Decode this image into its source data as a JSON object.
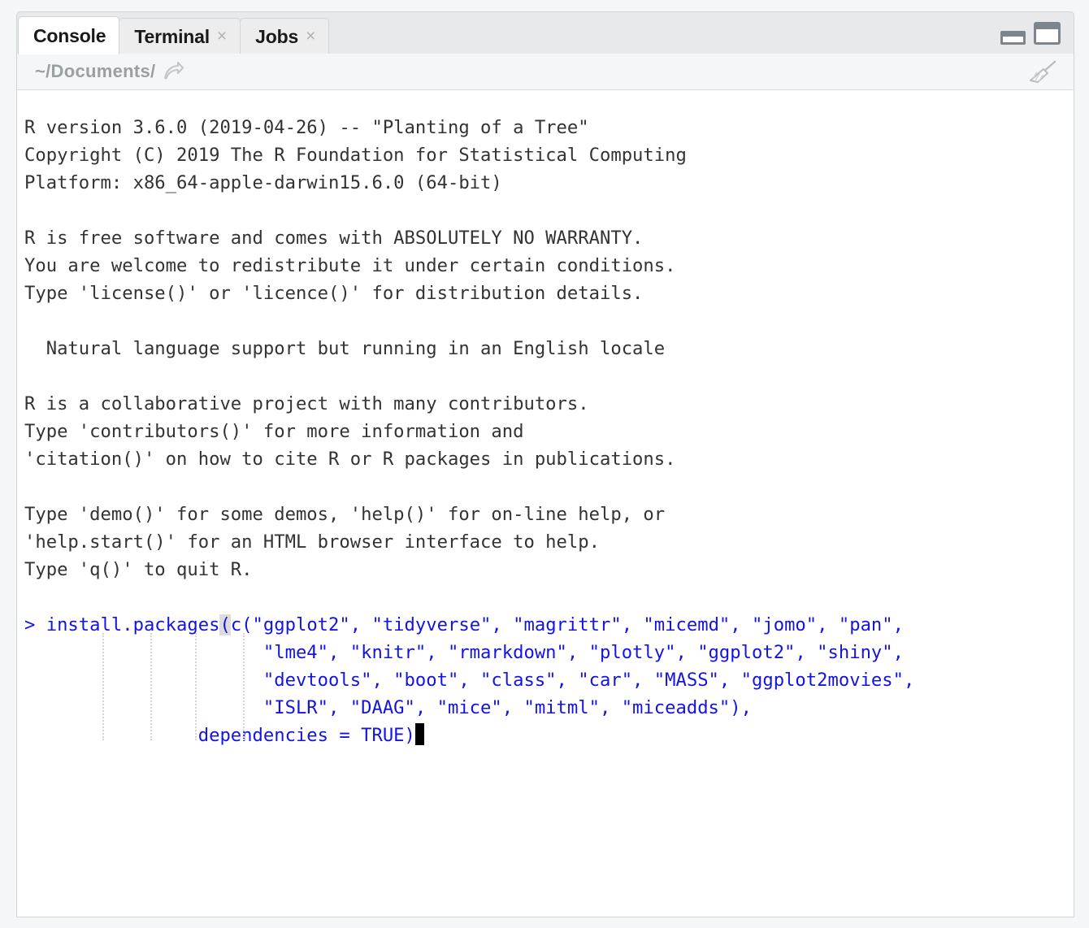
{
  "window": {
    "tabs": [
      {
        "label": "Console",
        "active": true,
        "closable": false
      },
      {
        "label": "Terminal",
        "active": false,
        "closable": true
      },
      {
        "label": "Jobs",
        "active": false,
        "closable": true
      }
    ],
    "close_glyph": "×",
    "minimize_label": "minimize-pane",
    "maximize_label": "maximize-pane"
  },
  "pathbar": {
    "path": "~/Documents/",
    "open_in_window_icon": "curved-arrow-icon",
    "clear_console_icon": "broom-icon"
  },
  "console": {
    "prompt": ">",
    "output_lines": [
      "R version 3.6.0 (2019-04-26) -- \"Planting of a Tree\"",
      "Copyright (C) 2019 The R Foundation for Statistical Computing",
      "Platform: x86_64-apple-darwin15.6.0 (64-bit)",
      "",
      "R is free software and comes with ABSOLUTELY NO WARRANTY.",
      "You are welcome to redistribute it under certain conditions.",
      "Type 'license()' or 'licence()' for distribution details.",
      "",
      "  Natural language support but running in an English locale",
      "",
      "R is a collaborative project with many contributors.",
      "Type 'contributors()' for more information and",
      "'citation()' on how to cite R or R packages in publications.",
      "",
      "Type 'demo()' for some demos, 'help()' for on-line help, or",
      "'help.start()' for an HTML browser interface to help.",
      "Type 'q()' to quit R.",
      ""
    ],
    "command": {
      "line1_prefix": "> install.packages",
      "line1_paren": "(",
      "line1_rest": "c(\"ggplot2\", \"tidyverse\", \"magrittr\", \"micemd\", \"jomo\", \"pan\",",
      "line2": "                      \"lme4\", \"knitr\", \"rmarkdown\", \"plotly\", \"ggplot2\", \"shiny\",",
      "line3": "                      \"devtools\", \"boot\", \"class\", \"car\", \"MASS\", \"ggplot2movies\",",
      "line4": "                      \"ISLR\", \"DAAG\", \"mice\", \"mitml\", \"miceadds\"),",
      "line5": "                dependencies = TRUE)",
      "packages": [
        "ggplot2",
        "tidyverse",
        "magrittr",
        "micemd",
        "jomo",
        "pan",
        "lme4",
        "knitr",
        "rmarkdown",
        "plotly",
        "ggplot2",
        "shiny",
        "devtools",
        "boot",
        "class",
        "car",
        "MASS",
        "ggplot2movies",
        "ISLR",
        "DAAG",
        "mice",
        "mitml",
        "miceadds"
      ],
      "argument": "dependencies = TRUE"
    }
  },
  "colors": {
    "command_blue": "#1414e0",
    "output_gray": "#333333",
    "tab_active_bg": "#ffffff",
    "tab_inactive_bg": "#ededee",
    "tabbar_bg": "#e7e9ea",
    "pathbar_bg": "#f3f7f8",
    "border": "#d3d6d8",
    "page_bg": "#f4f6f7"
  }
}
